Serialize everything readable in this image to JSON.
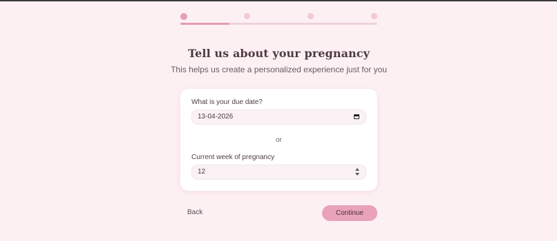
{
  "progress": {
    "steps": 4,
    "current_step": 1,
    "fill_fraction": 0.25
  },
  "header": {
    "title": "Tell us about your pregnancy",
    "subtitle": "This helps us create a personalized experience just for you"
  },
  "form": {
    "due_date": {
      "label": "What is your due date?",
      "value": "13-04-2026"
    },
    "separator": "or",
    "current_week": {
      "label": "Current week of pregnancy",
      "value": "12"
    }
  },
  "actions": {
    "back_label": "Back",
    "continue_label": "Continue"
  },
  "colors": {
    "background": "#fdf0f3",
    "accent": "#e8a3bb",
    "progress_fill": "#e59ab3",
    "step_active": "#e3a0b6",
    "step_inactive": "#f2c9d4"
  },
  "icons": {
    "date_field": "calendar-icon",
    "week_field": "spinner-arrows-icon"
  }
}
